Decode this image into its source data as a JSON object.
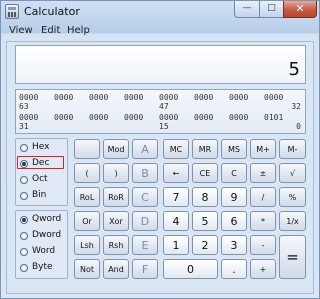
{
  "window": {
    "title": "Calculator",
    "minimize": "—",
    "maximize": "□",
    "close": "✕"
  },
  "menu": [
    "View",
    "Edit",
    "Help"
  ],
  "display": {
    "value": "5"
  },
  "binary_rows": [
    {
      "groups": [
        "0000",
        "0000",
        "0000",
        "0000",
        "0000",
        "0000",
        "0000",
        "0000"
      ],
      "indices": [
        {
          "label": "63",
          "pos": 0
        },
        {
          "label": "47",
          "pos": 4
        },
        {
          "label": "32",
          "pos": 7
        }
      ]
    },
    {
      "groups": [
        "0000",
        "0000",
        "0000",
        "0000",
        "0000",
        "0000",
        "0000",
        "0101"
      ],
      "indices": [
        {
          "label": "31",
          "pos": 0
        },
        {
          "label": "15",
          "pos": 4
        },
        {
          "label": "0",
          "pos": 7
        }
      ]
    }
  ],
  "base_options": [
    {
      "label": "Hex",
      "selected": false
    },
    {
      "label": "Dec",
      "selected": true
    },
    {
      "label": "Oct",
      "selected": false
    },
    {
      "label": "Bin",
      "selected": false
    }
  ],
  "word_options": [
    {
      "label": "Qword",
      "selected": true
    },
    {
      "label": "Dword",
      "selected": false
    },
    {
      "label": "Word",
      "selected": false
    },
    {
      "label": "Byte",
      "selected": false
    }
  ],
  "buttons": [
    [
      "",
      "Mod",
      "A",
      "MC",
      "MR",
      "MS",
      "M+",
      "M-"
    ],
    [
      "(",
      ")",
      "B",
      "←",
      "CE",
      "C",
      "±",
      "√"
    ],
    [
      "RoL",
      "RoR",
      "C",
      "7",
      "8",
      "9",
      "/",
      "%"
    ],
    [
      "Or",
      "Xor",
      "D",
      "4",
      "5",
      "6",
      "*",
      "1/x"
    ],
    [
      "Lsh",
      "Rsh",
      "E",
      "1",
      "2",
      "3",
      "-",
      "="
    ],
    [
      "Not",
      "And",
      "F",
      "0",
      ".",
      "+"
    ]
  ]
}
